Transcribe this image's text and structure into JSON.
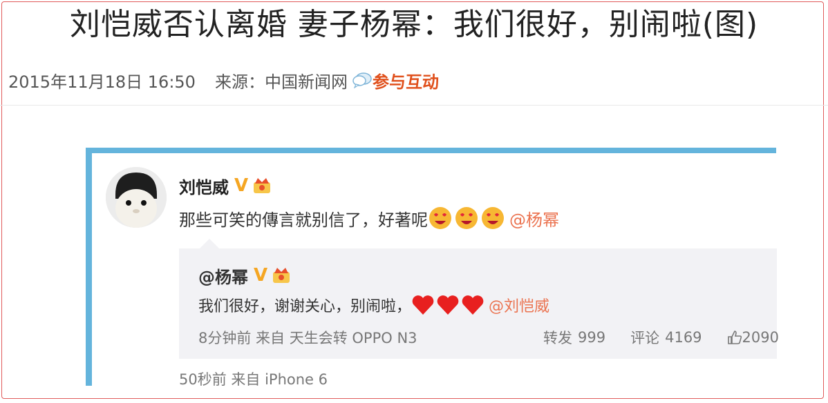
{
  "article": {
    "headline": "刘恺威否认离婚 妻子杨幂：我们很好，别闹啦(图)",
    "datetime": "2015年11月18日 16:50",
    "source": "来源：中国新闻网",
    "interact_label": "参与互动"
  },
  "weibo": {
    "author": "刘恺威",
    "verified_badge": "V",
    "text": "那些可笑的傳言就别信了，好著呢",
    "emoji_count": 3,
    "mention": "@杨幂",
    "repost": {
      "author": "@杨幂",
      "verified_badge": "V",
      "text": "我们很好，谢谢关心，别闹啦，",
      "heart_count": 3,
      "mention": "@刘恺威",
      "meta": "8分钟前 来自 天生会转 OPPO N3",
      "repost_label": "转发",
      "repost_count": "999",
      "comment_label": "评论",
      "comment_count": "4169",
      "like_count": "2090"
    },
    "meta": "50秒前 来自 iPhone 6"
  },
  "colors": {
    "frame_border": "#e05a5a",
    "accent_orange": "#e0501c",
    "weibo_blue": "#64b4dc",
    "mention": "#eb7350",
    "verified": "#f5a623"
  }
}
